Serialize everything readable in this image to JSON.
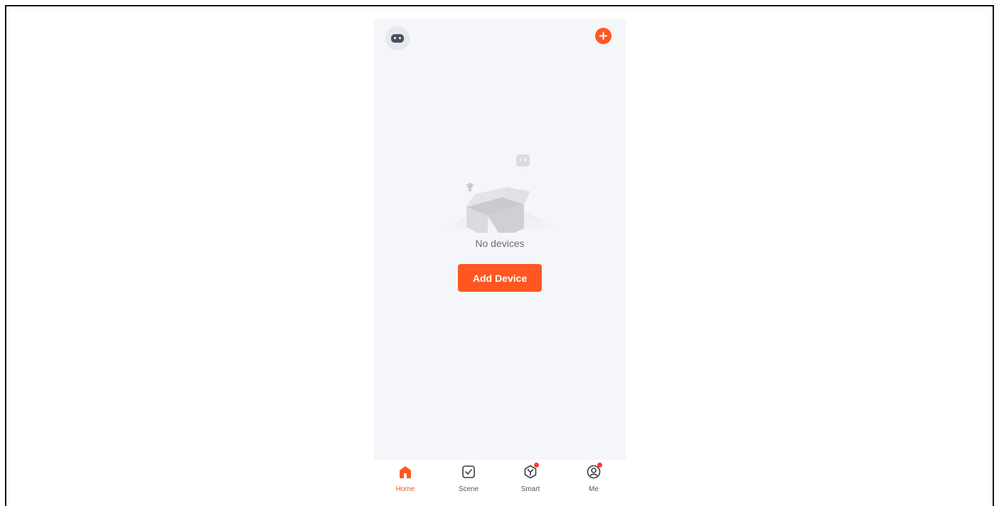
{
  "empty_state": {
    "message": "No devices",
    "action_label": "Add Device"
  },
  "tabs": [
    {
      "label": "Home",
      "icon": "home-icon",
      "active": true,
      "badge": false
    },
    {
      "label": "Scene",
      "icon": "scene-icon",
      "active": false,
      "badge": false
    },
    {
      "label": "Smart",
      "icon": "smart-icon",
      "active": false,
      "badge": true
    },
    {
      "label": "Me",
      "icon": "me-icon",
      "active": false,
      "badge": true
    }
  ],
  "colors": {
    "accent": "#fe5722",
    "background": "#f5f6fa",
    "badge": "#ff3b30",
    "tab_inactive": "#55575d"
  }
}
